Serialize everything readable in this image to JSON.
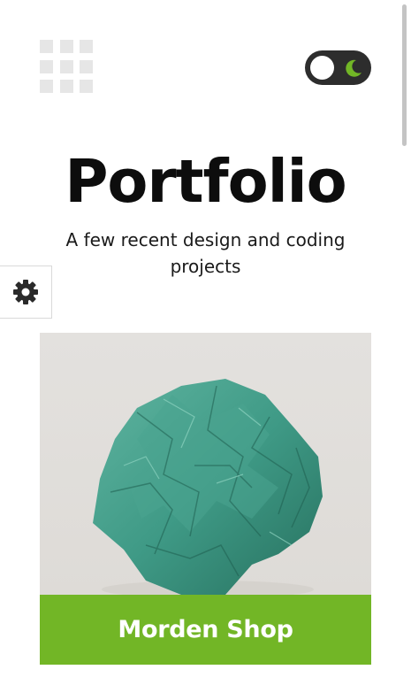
{
  "header": {
    "menu_icon": "grid-menu-icon",
    "theme_toggle": {
      "state": "light",
      "icon": "moon-icon",
      "icon_color": "#72b626",
      "track_color": "#2d2d2d"
    }
  },
  "hero": {
    "title": "Portfolio",
    "subtitle": "A few recent design and coding projects"
  },
  "settings": {
    "icon": "gear-icon"
  },
  "projects": [
    {
      "title": "Morden Shop",
      "image": "crumpled-paper-ball-image",
      "accent": "#72b626"
    }
  ]
}
